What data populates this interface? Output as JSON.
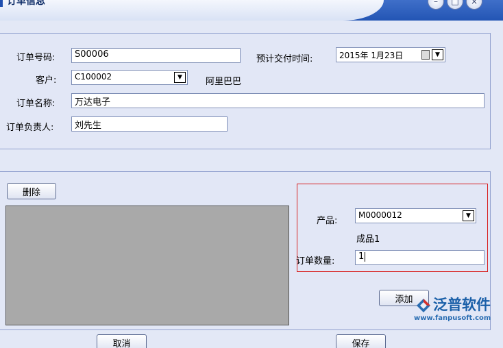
{
  "window": {
    "title": "订单信息"
  },
  "order": {
    "number_label": "订单号码:",
    "number_value": "S00006",
    "delivery_label": "预计交付时间:",
    "delivery_value": "2015年  1月23日",
    "customer_label": "客户:",
    "customer_value": "C100002",
    "customer_name": "阿里巴巴",
    "name_label": "订单名称:",
    "name_value": "万达电子",
    "owner_label": "订单负责人:",
    "owner_value": "刘先生"
  },
  "detail": {
    "delete_label": "删除",
    "product_label": "产品:",
    "product_value": "M0000012",
    "product_name": "成品1",
    "quantity_label": "订单数量:",
    "quantity_value": "1",
    "add_label": "添加"
  },
  "footer": {
    "cancel_label": "取消",
    "save_label": "保存"
  },
  "logo": {
    "name": "泛普软件",
    "url": "www.fanpusoft.com"
  },
  "icons": {
    "minimize": "minimize-icon",
    "restore": "restore-icon",
    "close": "close-icon",
    "dropdown": "chevron-down-icon",
    "calendar": "calendar-icon"
  },
  "colors": {
    "title_bar": "#2355b4",
    "highlight_border": "#d81e1e",
    "grid": "#a9a9a9",
    "logo": "#1a5fa8"
  }
}
